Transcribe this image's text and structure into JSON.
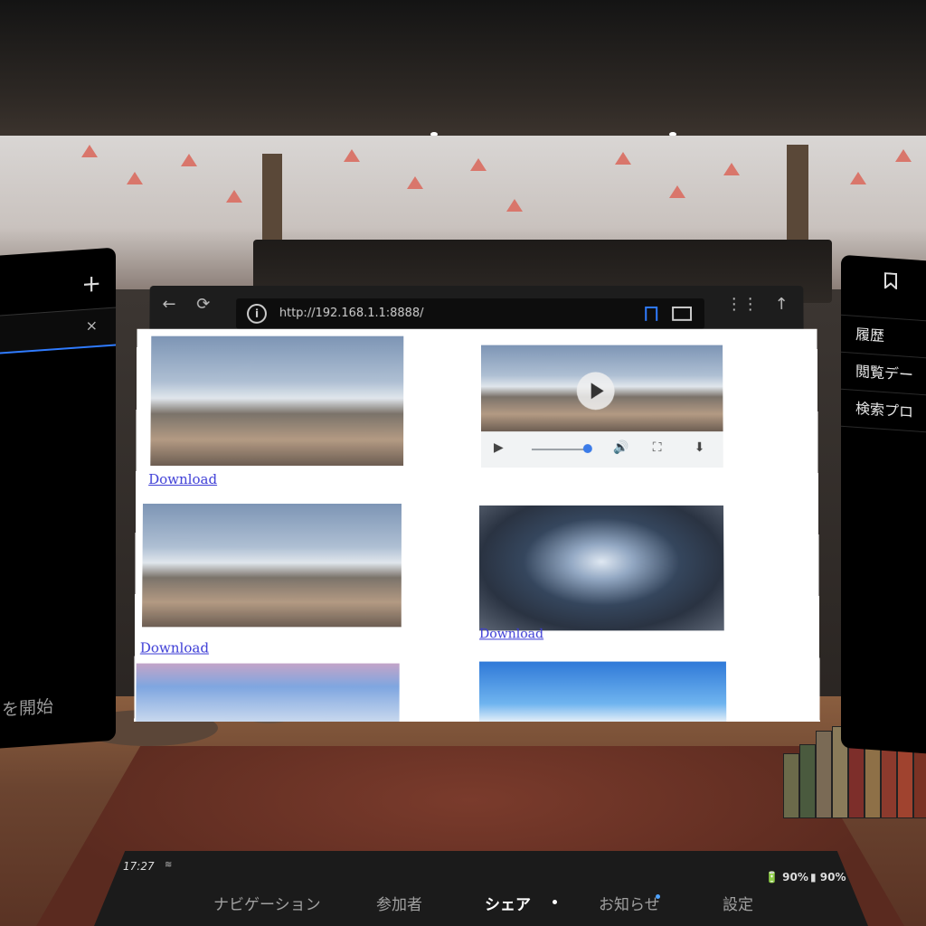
{
  "browser": {
    "url": "http://192.168.1.1:8888/",
    "back_icon": "arrow-left-icon",
    "reload_icon": "reload-icon",
    "info_icon": "info-icon",
    "bookmark_icon": "bookmark-icon",
    "display_icon": "screen-icon",
    "voice_icon": "voice-icon",
    "scroll_top_icon": "arrow-up-icon"
  },
  "content": {
    "items": [
      {
        "type": "image",
        "link": "Download"
      },
      {
        "type": "video",
        "controls": [
          "play-icon",
          "volume-icon",
          "fullscreen-icon",
          "download-icon"
        ]
      },
      {
        "type": "image",
        "link": "Download"
      },
      {
        "type": "image",
        "link": "Download"
      }
    ]
  },
  "left_panel": {
    "plus": "+",
    "close": "×",
    "start_text": "を開始"
  },
  "right_panel": {
    "menu": [
      "履歴",
      "閲覧デー",
      "検索プロ"
    ]
  },
  "dock": {
    "time": "17:27",
    "controller_battery": "90%",
    "headset_battery": "90%",
    "nav": [
      "ナビゲーション",
      "参加者",
      "シェア",
      "お知らせ",
      "設定"
    ],
    "active": "シェア"
  },
  "colors": {
    "accent": "#2f7bff",
    "link": "#3b3bd6",
    "video_progress": "#3b7be8",
    "notification": "#4ea3ff"
  }
}
